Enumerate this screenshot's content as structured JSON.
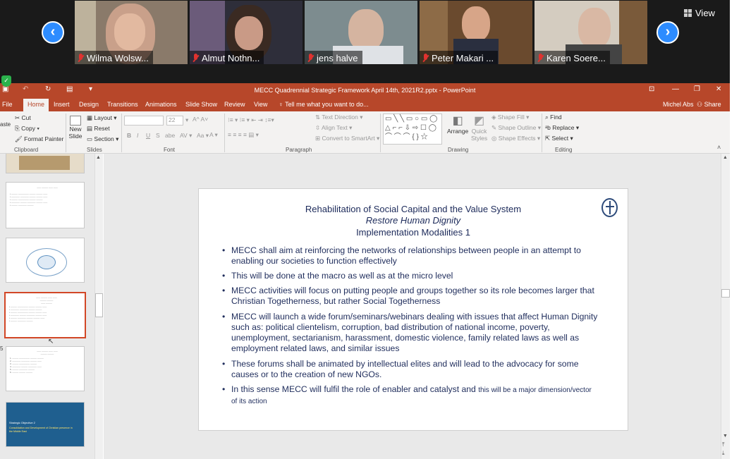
{
  "zoom": {
    "participants": [
      {
        "name": "Wilma Wolsw..."
      },
      {
        "name": "Almut Nothn..."
      },
      {
        "name": "jens halve"
      },
      {
        "name": "Peter Makari ..."
      },
      {
        "name": "Karen Soere..."
      }
    ],
    "view_label": "View"
  },
  "ppt": {
    "window_title": "MECC Quadrennial Strategic Framework April 14th, 2021R2.pptx - PowerPoint",
    "user": "Michel Abs",
    "share_label": "Share",
    "tabs": [
      "File",
      "Home",
      "Insert",
      "Design",
      "Transitions",
      "Animations",
      "Slide Show",
      "Review",
      "View"
    ],
    "active_tab": "Home",
    "tell_me": "Tell me what you want to do...",
    "ribbon": {
      "cut": "Cut",
      "copy": "Copy",
      "format_painter": "Format Painter",
      "paste": "aste",
      "clipboard": "Clipboard",
      "new_slide_1": "New",
      "new_slide_2": "Slide",
      "layout": "Layout",
      "reset": "Reset",
      "section": "Section",
      "slides": "Slides",
      "font_size": "22",
      "font": "Font",
      "text_direction": "Text Direction",
      "align_text": "Align Text",
      "convert_smartart": "Convert to SmartArt",
      "paragraph": "Paragraph",
      "arrange": "Arrange",
      "quick_styles_1": "Quick",
      "quick_styles_2": "Styles",
      "shape_fill": "Shape Fill",
      "shape_outline": "Shape Outline",
      "shape_effects": "Shape Effects",
      "drawing": "Drawing",
      "find": "Find",
      "replace": "Replace",
      "select": "Select",
      "editing": "Editing"
    },
    "thumb_numbers": [
      "5"
    ],
    "thumb_texts": {
      "t6_title": "Strategic Objective 2",
      "t6_sub": "Consolidation and Development of Christian presence in the Middle East"
    }
  },
  "slide": {
    "title": "Rehabilitation of Social Capital and the Value System",
    "subtitle": "Restore Human Dignity",
    "heading": "Implementation Modalities 1",
    "bullets": [
      {
        "text": "MECC shall aim at reinforcing the networks of relationships between people in an attempt to enabling our societies to function effectively"
      },
      {
        "text": "This will be done at the macro as well as at the micro level"
      },
      {
        "text": "MECC activities will focus on putting people and groups together so its role becomes larger that Christian Togetherness, but rather Social Togetherness"
      },
      {
        "text": "MECC will launch a wide forum/seminars/webinars dealing with issues that affect Human Dignity such as: political clientelism, corruption, bad distribution of national income, poverty, unemployment, sectarianism, harassment, domestic violence, family related laws as well as employment related laws, and similar issues"
      },
      {
        "text": "These forums shall be animated by intellectual elites and will lead to the advocacy for some causes or to the creation of new NGOs."
      },
      {
        "text": "In this sense MECC will fulfil the role of enabler and catalyst and ",
        "small": "this will be a major dimension/vector of its action"
      }
    ]
  },
  "colors": {
    "ppt_accent": "#b7472a",
    "zoom_blue": "#2d8cff",
    "selected_thumb": "#d24726",
    "slide_text": "#1f2d5c"
  }
}
